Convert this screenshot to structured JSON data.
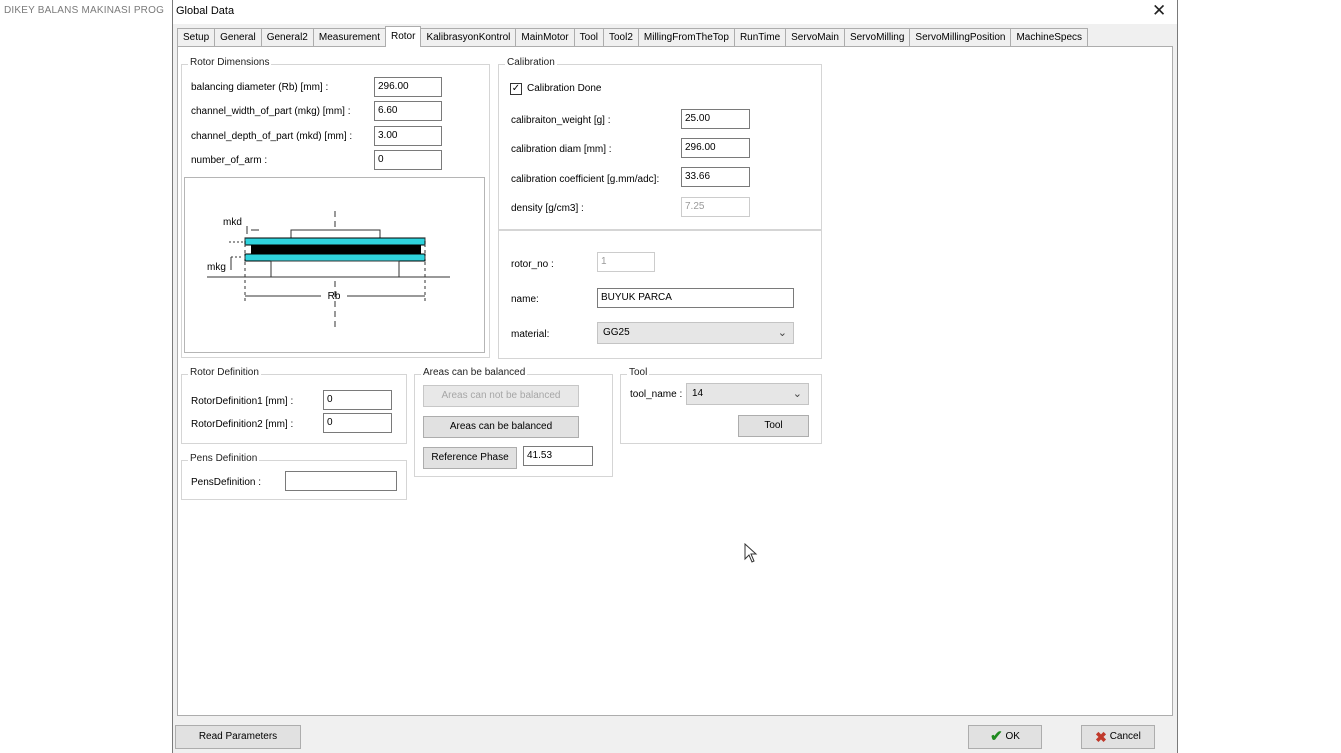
{
  "background_app_title": "DIKEY BALANS MAKINASI PROG",
  "window": {
    "title": "Global Data"
  },
  "tabs": [
    {
      "label": "Setup"
    },
    {
      "label": "General"
    },
    {
      "label": "General2"
    },
    {
      "label": "Measurement"
    },
    {
      "label": "Rotor",
      "active": true
    },
    {
      "label": "KalibrasyonKontrol"
    },
    {
      "label": "MainMotor"
    },
    {
      "label": "Tool"
    },
    {
      "label": "Tool2"
    },
    {
      "label": "MillingFromTheTop"
    },
    {
      "label": "RunTime"
    },
    {
      "label": "ServoMain"
    },
    {
      "label": "ServoMilling"
    },
    {
      "label": "ServoMillingPosition"
    },
    {
      "label": "MachineSpecs"
    }
  ],
  "rotor_dimensions": {
    "legend": "Rotor Dimensions",
    "fields": [
      {
        "label": "balancing diameter (Rb) [mm] :",
        "value": "296.00"
      },
      {
        "label": "channel_width_of_part (mkg) [mm] :",
        "value": "6.60"
      },
      {
        "label": "channel_depth_of_part (mkd) [mm] :",
        "value": "3.00"
      },
      {
        "label": "number_of_arm :",
        "value": "0"
      }
    ],
    "diagram": {
      "label_mkd": "mkd",
      "label_mkg": "mkg",
      "label_rb": "Rb"
    }
  },
  "calibration": {
    "legend": "Calibration",
    "calibration_done_label": "Calibration Done",
    "calibration_done_checked": true,
    "fields": [
      {
        "label": "calibraiton_weight [g] :",
        "value": "25.00"
      },
      {
        "label": "calibration diam [mm] :",
        "value": "296.00"
      },
      {
        "label": "calibration coefficient [g.mm/adc]:",
        "value": "33.66"
      },
      {
        "label": "density [g/cm3] :",
        "value": "7.25"
      }
    ]
  },
  "rotor_info": {
    "rotor_no_label": "rotor_no :",
    "rotor_no_value": "1",
    "name_label": "name:",
    "name_value": "BUYUK PARCA",
    "material_label": "material:",
    "material_value": "GG25"
  },
  "rotor_definition": {
    "legend": "Rotor Definition",
    "fields": [
      {
        "label": "RotorDefinition1 [mm] :",
        "value": "0"
      },
      {
        "label": "RotorDefinition2 [mm] :",
        "value": "0"
      }
    ]
  },
  "pens_definition": {
    "legend": "Pens Definition",
    "label": "PensDefinition :",
    "value": ""
  },
  "areas": {
    "legend": "Areas can be balanced",
    "btn_cannot": "Areas can not be balanced",
    "btn_can": "Areas can be balanced",
    "btn_reference_phase": "Reference Phase",
    "reference_phase_value": "41.53"
  },
  "tool": {
    "legend": "Tool",
    "tool_name_label": "tool_name :",
    "tool_name_value": "14",
    "tool_button": "Tool"
  },
  "footer": {
    "read_parameters": "Read Parameters",
    "ok": "OK",
    "cancel": "Cancel"
  },
  "colors": {
    "rotor_plate": "#2fd3dd",
    "rotor_core": "#000000",
    "ok_check": "#1f8a1f",
    "cancel_x": "#c0392b"
  },
  "icons": {
    "close": "close-icon",
    "check": "checkmark-icon",
    "cancel": "cancel-x-icon",
    "cursor": "mouse-cursor-icon"
  }
}
